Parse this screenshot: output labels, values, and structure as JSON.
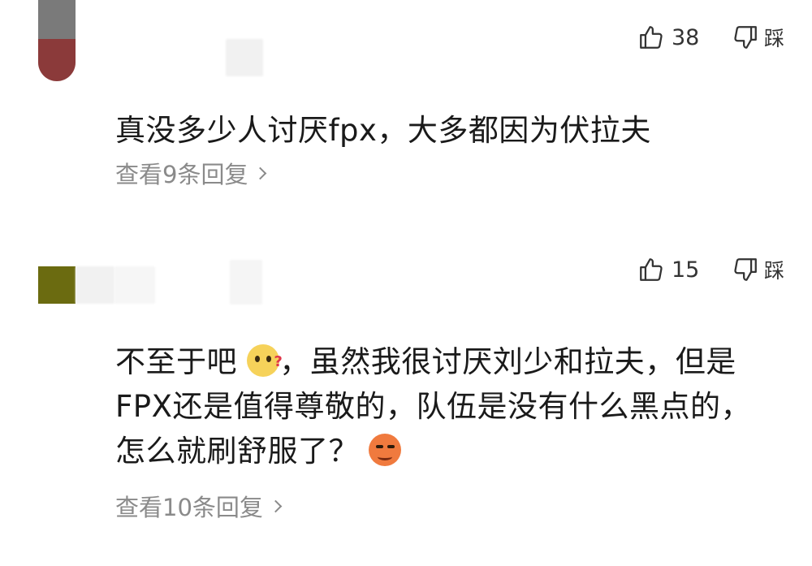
{
  "comments": [
    {
      "like_count": "38",
      "dislike_label": "踩",
      "text": "真没多少人讨厌fpx，大多都因为伏拉夫",
      "replies": "查看9条回复"
    },
    {
      "like_count": "15",
      "dislike_label": "踩",
      "text_part1": "不至于吧",
      "text_part2": "，虽然我很讨厌刘少和拉夫，但是FPX还是值得尊敬的，队伍是没有什么黑点的，怎么就刷舒服了？",
      "replies": "查看10条回复"
    }
  ],
  "icons": {
    "like": "thumbs-up-icon",
    "dislike": "thumbs-down-icon",
    "emoji_1": "thinking-emoji",
    "emoji_2": "smirk-emoji",
    "chevron": "chevron-right-icon"
  }
}
